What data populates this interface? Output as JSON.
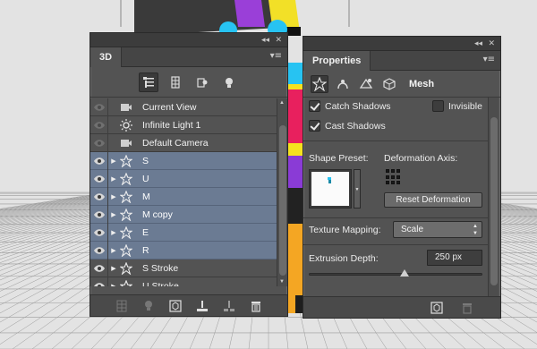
{
  "canvas": {
    "background": "#e2e2e2",
    "floor_grid_color": "#9a9a9a",
    "ring_color": "#27c3f2",
    "stripe_yellow": "#f5e21f",
    "magenta": "#e8205e",
    "purple": "#8a3bd6",
    "orange": "#f4a623"
  },
  "panel_3d": {
    "tab_label": "3D",
    "topbar": {
      "collapse_glyph": "◂◂",
      "close_glyph": "✕"
    },
    "menu_glyph": "▾≡",
    "filters": [
      {
        "name": "scene-filter-icon",
        "active": true
      },
      {
        "name": "meshes-filter-icon",
        "active": false
      },
      {
        "name": "materials-filter-icon",
        "active": false
      },
      {
        "name": "lights-filter-icon",
        "active": false
      }
    ],
    "rows": [
      {
        "label": "Current View",
        "icon": "camera-icon",
        "visible": false,
        "selected": false,
        "expandable": false
      },
      {
        "label": "Infinite Light 1",
        "icon": "light-icon",
        "visible": false,
        "selected": false,
        "expandable": false
      },
      {
        "label": "Default Camera",
        "icon": "camera-icon",
        "visible": false,
        "selected": false,
        "expandable": false
      },
      {
        "label": "S",
        "icon": "mesh-icon",
        "visible": true,
        "selected": true,
        "expandable": true
      },
      {
        "label": "U",
        "icon": "mesh-icon",
        "visible": true,
        "selected": true,
        "expandable": true
      },
      {
        "label": "M",
        "icon": "mesh-icon",
        "visible": true,
        "selected": true,
        "expandable": true
      },
      {
        "label": "M copy",
        "icon": "mesh-icon",
        "visible": true,
        "selected": true,
        "expandable": true
      },
      {
        "label": "E",
        "icon": "mesh-icon",
        "visible": true,
        "selected": true,
        "expandable": true
      },
      {
        "label": "R",
        "icon": "mesh-icon",
        "visible": true,
        "selected": true,
        "expandable": true
      },
      {
        "label": "S Stroke",
        "icon": "mesh-icon",
        "visible": true,
        "selected": false,
        "expandable": true
      },
      {
        "label": "U Stroke",
        "icon": "mesh-icon",
        "visible": true,
        "selected": false,
        "expandable": true
      }
    ]
  },
  "panel_props": {
    "tab_label": "Properties",
    "topbar": {
      "collapse_glyph": "◂◂",
      "close_glyph": "✕"
    },
    "menu_glyph": "▾≡",
    "section_title": "Mesh",
    "catch_shadows": {
      "label": "Catch Shadows",
      "checked": true
    },
    "invisible": {
      "label": "Invisible",
      "checked": false
    },
    "cast_shadows": {
      "label": "Cast Shadows",
      "checked": true
    },
    "shape_preset_label": "Shape Preset:",
    "deformation_axis_label": "Deformation Axis:",
    "reset_deformation_label": "Reset Deformation",
    "texture_mapping_label": "Texture Mapping:",
    "texture_mapping_value": "Scale",
    "extrusion_depth_label": "Extrusion Depth:",
    "extrusion_depth_value": "250 px",
    "extrusion_slider_fraction": 0.55
  }
}
